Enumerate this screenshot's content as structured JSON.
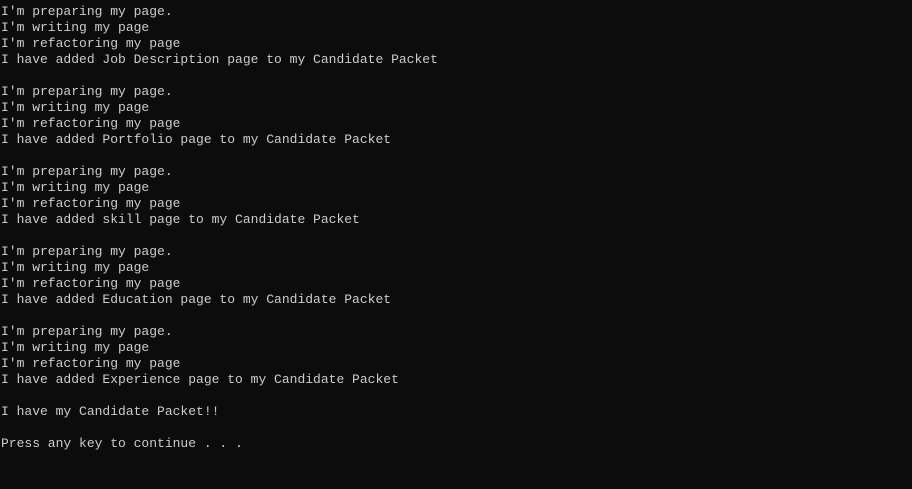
{
  "console": {
    "background": "#0c0c0c",
    "foreground": "#cccccc",
    "lines": [
      "I'm preparing my page.",
      "I'm writing my page",
      "I'm refactoring my page",
      "I have added Job Description page to my Candidate Packet",
      "",
      "I'm preparing my page.",
      "I'm writing my page",
      "I'm refactoring my page",
      "I have added Portfolio page to my Candidate Packet",
      "",
      "I'm preparing my page.",
      "I'm writing my page",
      "I'm refactoring my page",
      "I have added skill page to my Candidate Packet",
      "",
      "I'm preparing my page.",
      "I'm writing my page",
      "I'm refactoring my page",
      "I have added Education page to my Candidate Packet",
      "",
      "I'm preparing my page.",
      "I'm writing my page",
      "I'm refactoring my page",
      "I have added Experience page to my Candidate Packet",
      "",
      "I have my Candidate Packet!!",
      "",
      "Press any key to continue . . ."
    ]
  }
}
